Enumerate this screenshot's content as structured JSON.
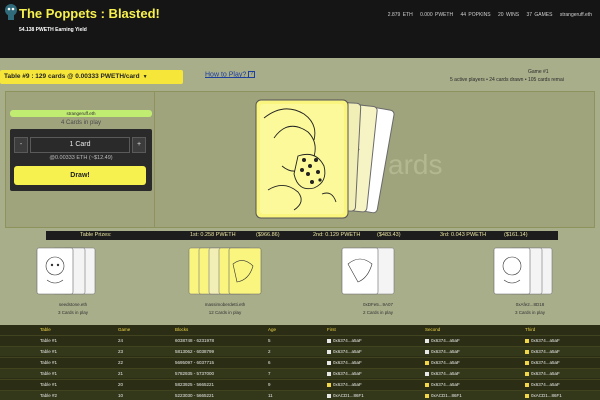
{
  "header": {
    "title": "The Poppets : Blasted!",
    "yield": "54.138 PWETH Earning Yield",
    "stats": [
      "2.879 ETH",
      "0.000 PWETH",
      "44 POPKINS",
      "20 WINS",
      "37 GAMES",
      "strangeruff.eth"
    ]
  },
  "table_bar": {
    "selector": "Table #9 : 129 cards @ 0.00333 PWETH/card",
    "howto": "How to Play?",
    "help_glyph": "?",
    "game": "Game #1",
    "players": "5 active players • 24 cards drawn • 105 cards remai"
  },
  "panel": {
    "player": "strangeruff.eth",
    "cards_in_play": "4 Cards in play",
    "minus": "-",
    "quantity": "1 Card",
    "plus": "+",
    "price": "@0.00333 ETH (~$12.49)",
    "draw": "Draw!"
  },
  "play_area": {
    "bg_text": "ards"
  },
  "prizes": {
    "label": "Table Prizes:",
    "first": "1st: 0.258 PWETH",
    "first_usd": "($966.86)",
    "second": "2nd: 0.129 PWETH",
    "second_usd": "($483.43)",
    "third": "3rd: 0.043 PWETH",
    "third_usd": "($161.14)"
  },
  "winners": [
    {
      "name": "seedstone.eth",
      "cards": "3 Cards in play"
    },
    {
      "name": "massimoberdetti.eth",
      "cards": "12 Cards in play"
    },
    {
      "name": "0xDFe5...9A07",
      "cards": "2 Cards in play"
    },
    {
      "name": "0xAfe2...8D18",
      "cards": "3 Cards in play"
    }
  ],
  "results": {
    "headers": [
      "Table",
      "Game",
      "Blocks",
      "Age",
      "First",
      "Second",
      "Third"
    ],
    "rows": [
      [
        "Table #1",
        "24",
        "6038748 - 6231978",
        "5",
        "0x6374...a5aF",
        "0x6374...a5aF",
        "0x6374...a5aF"
      ],
      [
        "Table #1",
        "23",
        "5813062 - 6038799",
        "2",
        "0x6374...a5aF",
        "0x6374...a5aF",
        "0x6374...a5aF"
      ],
      [
        "Table #1",
        "22",
        "5695097 - 6037715",
        "6",
        "0x6374...a5aF",
        "0x6374...a5aF",
        "0x6374...a5aF"
      ],
      [
        "Table #1",
        "21",
        "5782935 - 5737000",
        "7",
        "0x6374...a5aF",
        "0x6374...a5aF",
        "0x6374...a5aF"
      ],
      [
        "Table #1",
        "20",
        "5823925 - 5665221",
        "9",
        "0x6374...a5aF",
        "0x6374...a5aF",
        "0x6374...a5aF"
      ],
      [
        "Table #2",
        "10",
        "5223030 - 5665221",
        "11",
        "0xACD1...86F1",
        "0xACD1...86F1",
        "0xACD1...86F1"
      ]
    ],
    "marker_colors": [
      [
        "w",
        "w",
        "y"
      ],
      [
        "w",
        "w",
        "y"
      ],
      [
        "w",
        "y",
        "y"
      ],
      [
        "w",
        "w",
        "y"
      ],
      [
        "y",
        "y",
        "y"
      ],
      [
        "w",
        "y",
        "y"
      ]
    ]
  },
  "colors": {
    "accent": "#f6f14e",
    "header_bg": "#151515",
    "page_bg": "#a8ad8a",
    "player_tag": "#c0ec72"
  }
}
